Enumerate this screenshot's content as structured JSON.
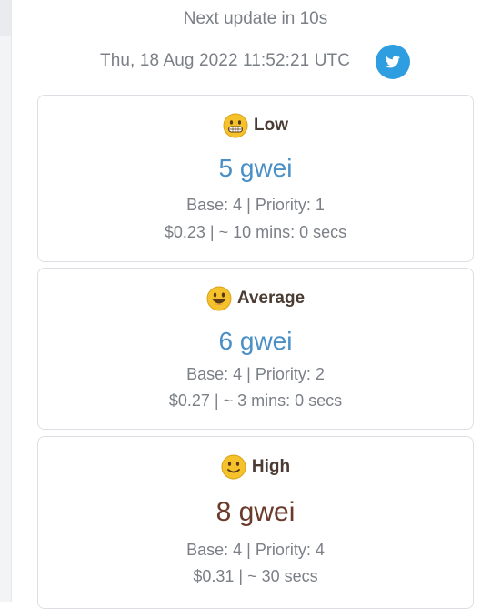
{
  "header": {
    "next_update": "Next update in 10s",
    "datetime": "Thu, 18 Aug 2022 11:52:21 UTC",
    "share_icon": "twitter-icon"
  },
  "colors": {
    "gwei_blue": "#4a8fc5",
    "gwei_brown": "#6b3a2a",
    "twitter_blue": "#2f9ee0",
    "muted_text": "#7b7f86"
  },
  "tiers": [
    {
      "icon": "grinning-face-icon",
      "label": "Low",
      "gwei": "5 gwei",
      "base_priority": "Base: 4 | Priority: 1",
      "cost_time": "$0.23 | ~ 10 mins: 0 secs"
    },
    {
      "icon": "smiling-face-icon",
      "label": "Average",
      "gwei": "6 gwei",
      "base_priority": "Base: 4 | Priority: 2",
      "cost_time": "$0.27 | ~ 3 mins: 0 secs"
    },
    {
      "icon": "slightly-smiling-face-icon",
      "label": "High",
      "gwei": "8 gwei",
      "base_priority": "Base: 4 | Priority: 4",
      "cost_time": "$0.31 | ~ 30 secs"
    }
  ]
}
